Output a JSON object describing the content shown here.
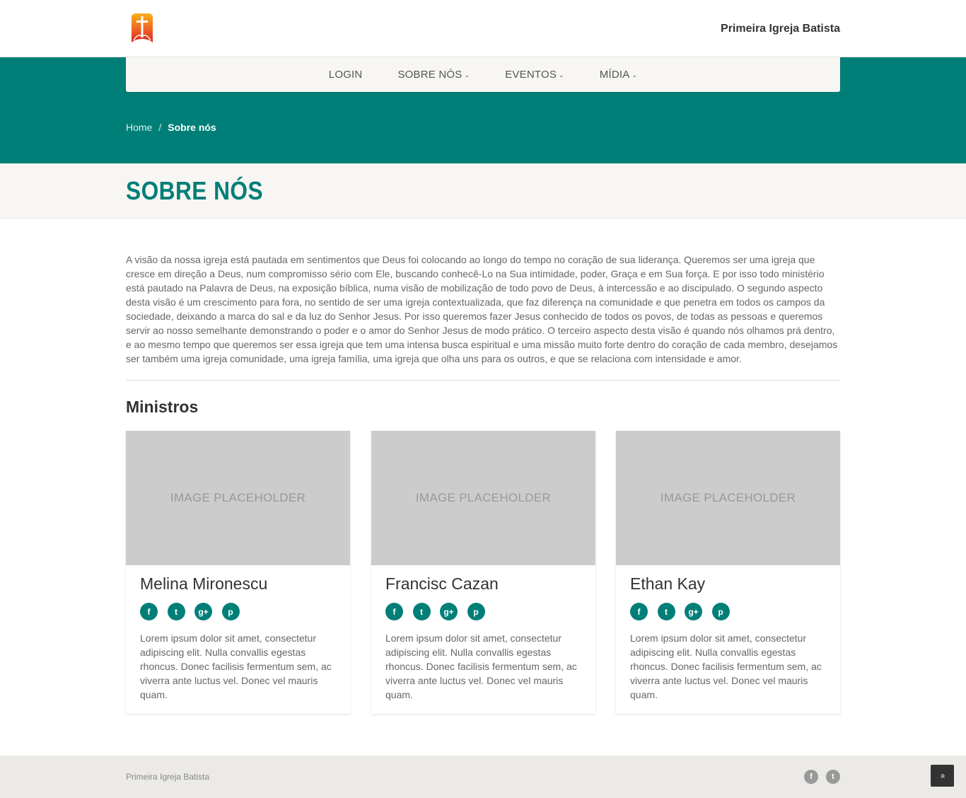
{
  "header": {
    "site_name": "Primeira Igreja Batista"
  },
  "nav": {
    "items": [
      {
        "label": "LOGIN",
        "caret": ""
      },
      {
        "label": "SOBRE NÓS",
        "caret": "⌄"
      },
      {
        "label": "EVENTOS",
        "caret": "⌄"
      },
      {
        "label": "MÍDIA",
        "caret": "⌄"
      }
    ]
  },
  "breadcrumb": {
    "home": "Home",
    "separator": "/",
    "current": "Sobre nós"
  },
  "page": {
    "title": "SOBRE NÓS",
    "intro": "A visão da nossa igreja está pautada em sentimentos que Deus foi colocando ao longo do tempo no coração de sua liderança. Queremos ser uma igreja que cresce em direção a Deus, num compromisso sério com Ele, buscando conhecê-Lo na Sua intimidade, poder, Graça e em Sua força. E por isso todo ministério está pautado na Palavra de Deus, na exposição bíblica, numa visão de mobilização de todo povo de Deus, à intercessão e ao discipulado. O segundo aspecto desta visão é um crescimento para fora, no sentido de ser uma igreja contextualizada, que faz diferença na comunidade e que penetra em todos os campos da sociedade, deixando a marca do sal e da luz do Senhor Jesus. Por isso queremos fazer Jesus conhecido de todos os povos, de todas as pessoas e queremos servir ao nosso semelhante demonstrando o poder e o amor do Senhor Jesus de modo prático. O terceiro aspecto desta visão é quando nós olhamos prá dentro, e ao mesmo tempo que queremos ser essa igreja que tem uma intensa busca espiritual e uma missão muito forte dentro do coração de cada membro, desejamos ser também uma igreja comunidade, uma igreja família, uma igreja que olha uns para os outros, e que se relaciona com intensidade e amor.",
    "section_title": "Ministros"
  },
  "ministers": [
    {
      "image_placeholder": "IMAGE PLACEHOLDER",
      "name": "Melina Mironescu",
      "description": "Lorem ipsum dolor sit amet, consectetur adipiscing elit. Nulla convallis egestas rhoncus. Donec facilisis fermentum sem, ac viverra ante luctus vel. Donec vel mauris quam."
    },
    {
      "image_placeholder": "IMAGE PLACEHOLDER",
      "name": "Francisc Cazan",
      "description": "Lorem ipsum dolor sit amet, consectetur adipiscing elit. Nulla convallis egestas rhoncus. Donec facilisis fermentum sem, ac viverra ante luctus vel. Donec vel mauris quam."
    },
    {
      "image_placeholder": "IMAGE PLACEHOLDER",
      "name": "Ethan Kay",
      "description": "Lorem ipsum dolor sit amet, consectetur adipiscing elit. Nulla convallis egestas rhoncus. Donec facilisis fermentum sem, ac viverra ante luctus vel. Donec vel mauris quam."
    }
  ],
  "social_icons": {
    "facebook": "f",
    "twitter": "t",
    "google_plus": "g+",
    "pinterest": "p"
  },
  "footer": {
    "text": "Primeira Igreja Batista"
  },
  "back_to_top": "»",
  "colors": {
    "accent": "#007f78",
    "title_band": "#f7f6f3",
    "footer": "#ebeae6",
    "placeholder": "#cccccc"
  }
}
